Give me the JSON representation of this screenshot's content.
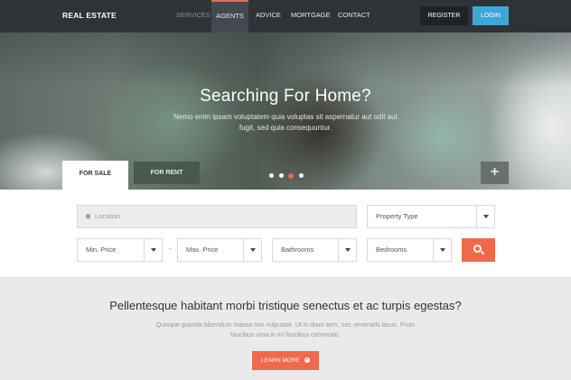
{
  "nav": {
    "brand": "REAL ESTATE",
    "links": [
      {
        "label": "SERVICES"
      },
      {
        "label": "AGENTS"
      },
      {
        "label": "ADVICE"
      },
      {
        "label": "MORTGAGE"
      },
      {
        "label": "CONTACT"
      }
    ],
    "active_link": "AGENTS",
    "register_label": "REGISTER",
    "login_label": "LOGIN"
  },
  "hero": {
    "title": "Searching For Home?",
    "subtitle": "Nemo enim ipsam voluptatem quia voluptas sit aspernatur aut odit aut fugit, sed quia consequuntur.",
    "slide_count": 4,
    "active_slide": 3
  },
  "tabs": {
    "for_sale": "FOR SALE",
    "for_rent": "FOR RENT",
    "active": "FOR SALE",
    "add_icon": "plus-icon"
  },
  "search": {
    "location_placeholder": "Location",
    "property_type": "Property Type",
    "min_price": "Min. Price",
    "max_price": "Max. Price",
    "bathrooms": "Bathrooms",
    "bedrooms": "Bedrooms",
    "range_separator": "-",
    "search_icon": "search-icon"
  },
  "cta": {
    "title": "Pellentesque habitant morbi tristique senectus et ac turpis egestas?",
    "text": "Quisque gravida bibendum massa non vulputate. Ut in diam sem, nec venenatis lacus. Proin faucibus urna in mi faucibus commodo.",
    "button_label": "LEARN MORE"
  },
  "colors": {
    "accent": "#f0694a",
    "login": "#3fa7d6",
    "nav_bg": "#2f3338"
  }
}
